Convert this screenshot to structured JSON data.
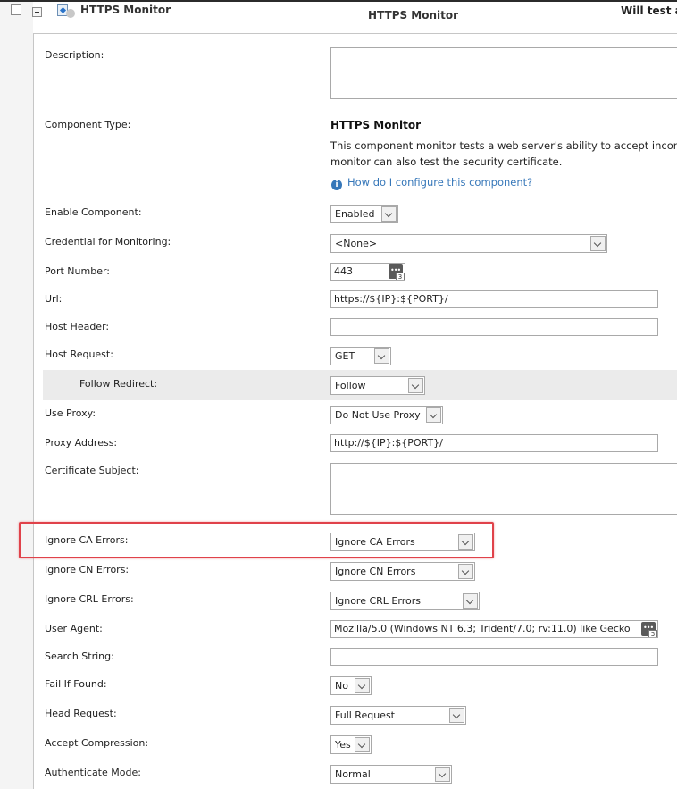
{
  "header": {
    "monitor_name": "HTTPS Monitor",
    "type_label": "HTTPS Monitor",
    "right_text": "Will test ag"
  },
  "form": {
    "description": {
      "label": "Description:",
      "value": ""
    },
    "component_type": {
      "label": "Component Type:",
      "title": "HTTPS Monitor",
      "description_line1": "This component monitor tests a web server's ability to accept incomin",
      "description_line2": "monitor can also test the security certificate.",
      "help_link": "How do I configure this component?"
    },
    "enable_component": {
      "label": "Enable Component:",
      "value": "Enabled"
    },
    "credential": {
      "label": "Credential for Monitoring:",
      "value": "<None>"
    },
    "port_number": {
      "label": "Port Number:",
      "value": "443"
    },
    "url": {
      "label": "Url:",
      "value": "https://${IP}:${PORT}/"
    },
    "host_header": {
      "label": "Host Header:",
      "value": ""
    },
    "host_request": {
      "label": "Host Request:",
      "value": "GET"
    },
    "follow_redirect": {
      "label": "Follow Redirect:",
      "value": "Follow"
    },
    "use_proxy": {
      "label": "Use Proxy:",
      "value": "Do Not Use Proxy"
    },
    "proxy_address": {
      "label": "Proxy Address:",
      "value": "http://${IP}:${PORT}/"
    },
    "certificate_subject": {
      "label": "Certificate Subject:",
      "value": ""
    },
    "ignore_ca_errors": {
      "label": "Ignore CA Errors:",
      "value": "Ignore CA Errors"
    },
    "ignore_cn_errors": {
      "label": "Ignore CN Errors:",
      "value": "Ignore CN Errors"
    },
    "ignore_crl_errors": {
      "label": "Ignore CRL Errors:",
      "value": "Ignore CRL Errors"
    },
    "user_agent": {
      "label": "User Agent:",
      "value": "Mozilla/5.0 (Windows NT 6.3; Trident/7.0; rv:11.0) like Gecko"
    },
    "search_string": {
      "label": "Search String:",
      "value": ""
    },
    "fail_if_found": {
      "label": "Fail If Found:",
      "value": "No"
    },
    "head_request": {
      "label": "Head Request:",
      "value": "Full Request"
    },
    "accept_compression": {
      "label": "Accept Compression:",
      "value": "Yes"
    },
    "authenticate_mode": {
      "label": "Authenticate Mode:",
      "value": "Normal"
    }
  },
  "colors": {
    "highlight": "#e0424a",
    "link": "#3677b9"
  }
}
